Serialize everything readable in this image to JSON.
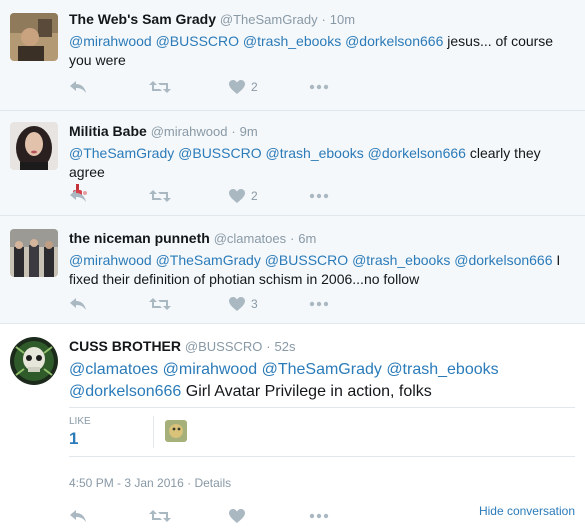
{
  "tweets": [
    {
      "name": "The Web's Sam Grady",
      "handle": "@TheSamGrady",
      "time": "10m",
      "mentions": [
        "@mirahwood",
        "@BUSSCRO",
        "@trash_ebooks",
        "@dorkelson666"
      ],
      "text": "jesus... of course you were",
      "likes": "2"
    },
    {
      "name": "Militia Babe",
      "handle": "@mirahwood",
      "time": "9m",
      "mentions": [
        "@TheSamGrady",
        "@BUSSCRO",
        "@trash_ebooks",
        "@dorkelson666"
      ],
      "text": "clearly they agree",
      "likes": "2"
    },
    {
      "name": "the niceman punneth",
      "handle": "@clamatoes",
      "time": "6m",
      "mentions": [
        "@mirahwood",
        "@TheSamGrady",
        "@BUSSCRO",
        "@trash_ebooks",
        "@dorkelson666"
      ],
      "text": "I fixed their definition of photian schism in 2006...no follow",
      "likes": "3"
    }
  ],
  "main_tweet": {
    "name": "CUSS BROTHER",
    "handle": "@BUSSCRO",
    "time": "52s",
    "mentions": [
      "@clamatoes",
      "@mirahwood",
      "@TheSamGrady",
      "@trash_ebooks",
      "@dorkelson666"
    ],
    "text": "Girl Avatar Privilege in action, folks",
    "like_label": "LIKE",
    "like_count": "1",
    "timestamp": "4:50 PM - 3 Jan 2016",
    "details": "Details",
    "hide_conversation": "Hide conversation"
  },
  "colors": {
    "link": "#2b7bb9",
    "reply_bg": "#f5f8fa",
    "icon": "#aab8c2"
  }
}
